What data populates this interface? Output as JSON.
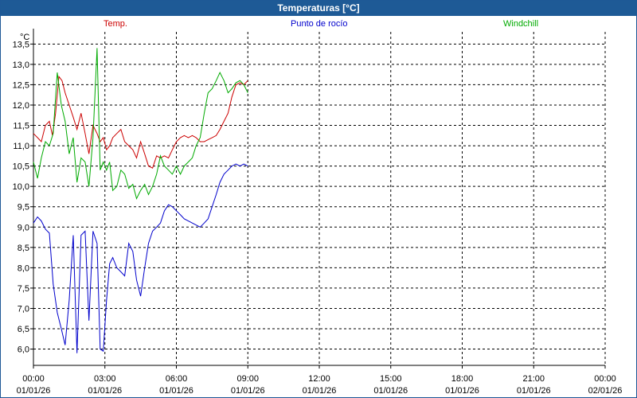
{
  "window": {
    "title": "Temperaturas [°C]"
  },
  "colors": {
    "titlebar": "#1e5a96"
  },
  "chart_data": {
    "type": "line",
    "title": "Temperaturas [°C]",
    "ylabel": "°C",
    "xlabel": "",
    "ylim": [
      5.6,
      13.8
    ],
    "xlim": [
      0,
      24
    ],
    "grid": true,
    "legend_placement": "top",
    "y_ticks": [
      "6,0",
      "6,5",
      "7,0",
      "7,5",
      "8,0",
      "8,5",
      "9,0",
      "9,5",
      "10,0",
      "10,5",
      "11,0",
      "11,5",
      "12,0",
      "12,5",
      "13,0",
      "13,5"
    ],
    "x_ticks": [
      {
        "time": "00:00",
        "date": "01/01/26"
      },
      {
        "time": "03:00",
        "date": "01/01/26"
      },
      {
        "time": "06:00",
        "date": "01/01/26"
      },
      {
        "time": "09:00",
        "date": "01/01/26"
      },
      {
        "time": "12:00",
        "date": "01/01/26"
      },
      {
        "time": "15:00",
        "date": "01/01/26"
      },
      {
        "time": "18:00",
        "date": "01/01/26"
      },
      {
        "time": "21:00",
        "date": "01/01/26"
      },
      {
        "time": "00:00",
        "date": "02/01/26"
      }
    ],
    "series": [
      {
        "name": "Temp.",
        "color": "#cc0000",
        "x": [
          0,
          0.17,
          0.33,
          0.5,
          0.67,
          0.8,
          0.93,
          1.07,
          1.2,
          1.33,
          1.5,
          1.67,
          1.83,
          2.0,
          2.17,
          2.33,
          2.5,
          2.67,
          2.8,
          2.93,
          3.07,
          3.2,
          3.33,
          3.5,
          3.67,
          3.83,
          4.0,
          4.17,
          4.33,
          4.5,
          4.67,
          4.83,
          5.0,
          5.17,
          5.33,
          5.5,
          5.67,
          5.83,
          6.0,
          6.17,
          6.33,
          6.5,
          6.67,
          6.83,
          7.0,
          7.17,
          7.33,
          7.5,
          7.67,
          7.83,
          8.0,
          8.17,
          8.33,
          8.5,
          8.67,
          8.83,
          9.0
        ],
        "y": [
          11.3,
          11.2,
          11.1,
          11.5,
          11.6,
          11.25,
          11.8,
          12.7,
          12.6,
          12.3,
          12.0,
          11.7,
          11.4,
          11.8,
          11.3,
          10.8,
          11.5,
          11.3,
          11.1,
          11.2,
          10.9,
          11.0,
          11.2,
          11.3,
          11.4,
          11.1,
          11.0,
          10.9,
          10.7,
          11.1,
          10.8,
          10.5,
          10.45,
          10.75,
          10.7,
          10.75,
          10.7,
          10.9,
          11.1,
          11.2,
          11.25,
          11.2,
          11.25,
          11.2,
          11.1,
          11.1,
          11.15,
          11.2,
          11.25,
          11.4,
          11.6,
          11.8,
          12.2,
          12.5,
          12.55,
          12.5,
          12.6
        ]
      },
      {
        "name": "Punto de rocío",
        "color": "#0000cc",
        "x": [
          0,
          0.17,
          0.33,
          0.5,
          0.67,
          0.83,
          1.0,
          1.17,
          1.33,
          1.5,
          1.67,
          1.83,
          2.0,
          2.17,
          2.33,
          2.5,
          2.67,
          2.8,
          2.93,
          3.07,
          3.2,
          3.33,
          3.5,
          3.67,
          3.83,
          4.0,
          4.17,
          4.33,
          4.5,
          4.67,
          4.83,
          5.0,
          5.17,
          5.33,
          5.5,
          5.67,
          5.83,
          6.0,
          6.17,
          6.33,
          6.5,
          6.67,
          6.83,
          7.0,
          7.17,
          7.33,
          7.5,
          7.67,
          7.83,
          8.0,
          8.17,
          8.33,
          8.5,
          8.67,
          8.83,
          9.0
        ],
        "y": [
          9.1,
          9.25,
          9.15,
          8.95,
          8.85,
          7.6,
          6.9,
          6.5,
          6.1,
          7.2,
          8.8,
          5.9,
          8.8,
          8.9,
          6.7,
          8.9,
          8.6,
          6.0,
          5.95,
          7.2,
          8.1,
          8.25,
          8.0,
          7.9,
          7.8,
          8.6,
          8.4,
          7.7,
          7.3,
          8.0,
          8.6,
          8.9,
          9.0,
          9.1,
          9.4,
          9.55,
          9.5,
          9.4,
          9.3,
          9.2,
          9.15,
          9.1,
          9.05,
          9.0,
          9.1,
          9.2,
          9.5,
          9.8,
          10.1,
          10.3,
          10.4,
          10.5,
          10.55,
          10.5,
          10.55,
          10.5
        ]
      },
      {
        "name": "Windchill",
        "color": "#00aa00",
        "x": [
          0,
          0.17,
          0.33,
          0.5,
          0.67,
          0.83,
          1.0,
          1.17,
          1.33,
          1.5,
          1.67,
          1.83,
          2.0,
          2.17,
          2.33,
          2.5,
          2.67,
          2.8,
          2.93,
          3.07,
          3.2,
          3.33,
          3.5,
          3.67,
          3.83,
          4.0,
          4.17,
          4.33,
          4.5,
          4.67,
          4.83,
          5.0,
          5.17,
          5.33,
          5.5,
          5.67,
          5.83,
          6.0,
          6.17,
          6.33,
          6.5,
          6.67,
          6.83,
          7.0,
          7.17,
          7.33,
          7.5,
          7.67,
          7.83,
          8.0,
          8.17,
          8.33,
          8.5,
          8.67,
          8.83,
          9.0
        ],
        "y": [
          10.6,
          10.2,
          10.7,
          11.1,
          11.0,
          11.3,
          12.8,
          12.0,
          11.6,
          10.8,
          11.2,
          10.1,
          10.7,
          10.6,
          10.0,
          11.2,
          13.4,
          10.4,
          10.6,
          10.4,
          10.6,
          9.9,
          10.0,
          10.4,
          10.3,
          9.95,
          10.05,
          9.7,
          9.9,
          10.05,
          9.8,
          10.0,
          10.3,
          10.75,
          10.5,
          10.4,
          10.3,
          10.5,
          10.3,
          10.5,
          10.6,
          10.7,
          11.0,
          11.2,
          11.8,
          12.3,
          12.4,
          12.6,
          12.8,
          12.6,
          12.3,
          12.4,
          12.55,
          12.6,
          12.5,
          12.3
        ]
      }
    ]
  }
}
